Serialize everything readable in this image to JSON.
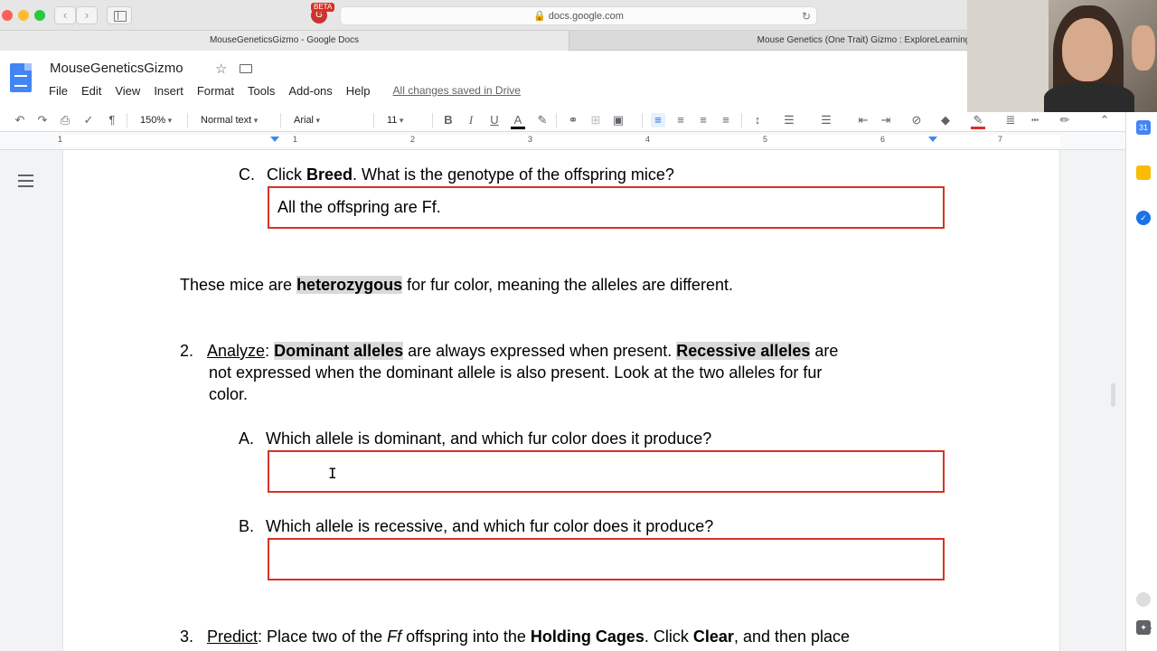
{
  "browser": {
    "url": "docs.google.com",
    "ext_badge": "BETA",
    "tabs": [
      {
        "label": "MouseGeneticsGizmo - Google Docs"
      },
      {
        "label": "Mouse Genetics (One Trait) Gizmo : ExploreLearning"
      }
    ]
  },
  "docs": {
    "title": "MouseGeneticsGizmo",
    "menu": [
      "File",
      "Edit",
      "View",
      "Insert",
      "Format",
      "Tools",
      "Add-ons",
      "Help"
    ],
    "save_status": "All changes saved in Drive",
    "toolbar": {
      "zoom": "150%",
      "style": "Normal text",
      "font": "Arial",
      "size": "11"
    },
    "ruler_numbers": [
      "1",
      "1",
      "2",
      "3",
      "4",
      "5",
      "6",
      "7"
    ]
  },
  "content": {
    "qC": {
      "marker": "C.",
      "pre": "Click ",
      "bold": "Breed",
      "post": ". What is the genotype of the offspring mice?"
    },
    "qC_answer": "All the offspring are Ff.",
    "hetero": {
      "pre": "These mice are ",
      "bold": "heterozygous",
      "post": " for fur color, meaning the alleles are different."
    },
    "q2": {
      "number": "2.",
      "label": "Analyze",
      "colon": ": ",
      "dom": "Dominant alleles",
      "mid": " are always expressed when present. ",
      "rec": "Recessive alleles",
      "end": " are",
      "line2": "not expressed when the dominant allele is also present. Look at the two alleles for fur",
      "line3": "color."
    },
    "qA": {
      "marker": "A.",
      "text": "Which allele is dominant, and which fur color does it produce?"
    },
    "qA_answer": "",
    "qB": {
      "marker": "B.",
      "text": "Which allele is recessive, and which fur color does it produce?"
    },
    "qB_answer": "",
    "q3": {
      "number": "3.",
      "label": "Predict",
      "a": ": Place two of the ",
      "ff": "Ff",
      "b": " offspring into the ",
      "cages": "Holding Cages",
      "c": ". Click ",
      "clear": "Clear",
      "d": ", and then place"
    }
  },
  "side_panel": {
    "calendar_label": "31"
  },
  "colors": {
    "answer_border": "#d93025",
    "highlight": "#d9d9d9",
    "docs_blue": "#4285f4"
  }
}
